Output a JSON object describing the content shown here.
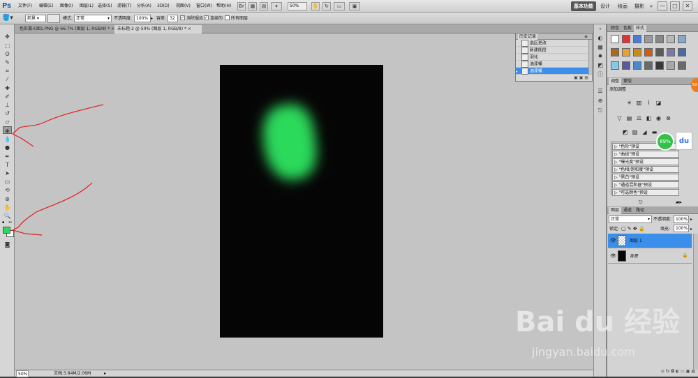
{
  "app": {
    "logo": "Ps"
  },
  "menubar": {
    "items": [
      "文件(F)",
      "编辑(E)",
      "图像(I)",
      "图层(L)",
      "选择(S)",
      "滤镜(T)",
      "分析(A)",
      "3D(D)",
      "视图(V)",
      "窗口(W)",
      "帮助(H)"
    ],
    "zoom": "50%",
    "workspaces": [
      "基本功能",
      "设计",
      "绘画",
      "摄影",
      "»"
    ],
    "window_buttons": {
      "min": "—",
      "max": "□",
      "close": "✕"
    }
  },
  "options_bar": {
    "fill_source": "前景",
    "mode_label": "模式:",
    "mode_value": "正常",
    "opacity_label": "不透明度:",
    "opacity_value": "100%",
    "tolerance_label": "容差:",
    "tolerance_value": "32",
    "antialias_label": "消除锯齿",
    "contiguous_label": "连续的",
    "all_layers_label": "所有图层"
  },
  "doc_tabs": [
    {
      "label": "色彩漏斗图1.PNG @ 66.7% (图层 1, RGB/8) *",
      "close": "×",
      "active": false
    },
    {
      "label": "未标题-2 @ 50% (图层 1, RGB/8) *",
      "close": "×",
      "active": true
    }
  ],
  "history_panel": {
    "title": "历史记录",
    "rows": [
      {
        "label": "选区更改",
        "selected": false
      },
      {
        "label": "新建图层",
        "selected": false
      },
      {
        "label": "羽化",
        "selected": false
      },
      {
        "label": "油漆桶",
        "selected": false
      },
      {
        "label": "油漆桶",
        "selected": true
      }
    ]
  },
  "swatches_panel": {
    "tabs": [
      "颜色",
      "色板",
      "样式"
    ],
    "active_tab": "样式",
    "swatch_colors": [
      "#ffffff",
      "#e03434",
      "#4a7ed4",
      "#9a9a9a",
      "#888888",
      "#b8b8b8",
      "#8aa8c8",
      "#a86a20",
      "#e2a23a",
      "#c88a1c",
      "#d05a18",
      "#5a5a5a",
      "#7a7aa8",
      "#4a6aa8",
      "#8ac8e8",
      "#5a5a9a",
      "#4a8ac8",
      "#6a6a6a",
      "#3a3a3a",
      "#a8a8a8",
      "#6a6a6a"
    ]
  },
  "adjustments_panel": {
    "tabs": [
      "调整",
      "蒙版"
    ],
    "active_tab": "调整",
    "title": "添加调整",
    "presets": [
      "\"色阶\"预设",
      "\"曲线\"预设",
      "\"曝光度\"预设",
      "\"色相/饱和度\"预设",
      "\"黑白\"预设",
      "\"通道混和器\"预设",
      "\"可选颜色\"预设"
    ]
  },
  "layers_panel": {
    "tabs": [
      "图层",
      "通道",
      "路径"
    ],
    "active_tab": "图层",
    "blend_mode": "正常",
    "opacity_label": "不透明度:",
    "opacity_value": "100%",
    "lock_label": "锁定:",
    "fill_label": "填充:",
    "fill_value": "100%",
    "layers": [
      {
        "name": "图层 1",
        "selected": true
      },
      {
        "name": "背景",
        "selected": false
      }
    ]
  },
  "status_bar": {
    "zoom": "50%",
    "doc_info": "文档:3.84M/2.06M"
  },
  "overlay": {
    "percent_badge": "69%",
    "du_button": "du",
    "orange_badge": "69",
    "watermark": "Bai du 经验",
    "watermark_url": "jingyan.baidu.com"
  },
  "colors": {
    "foreground": "#2bd95b",
    "background": "#ffffff",
    "canvas_fill": "#050505",
    "selection_blue": "#3b8ee9",
    "annotation_red": "#e02020"
  }
}
